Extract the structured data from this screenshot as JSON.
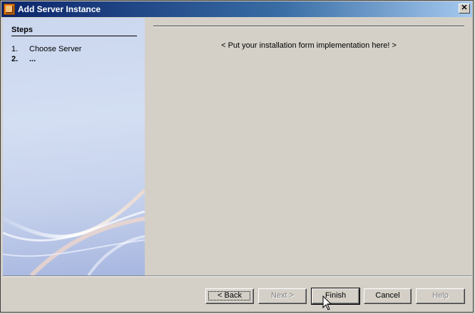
{
  "window": {
    "title": "Add Server Instance",
    "close_glyph": "✕"
  },
  "steps": {
    "title": "Steps",
    "items": [
      {
        "number": "1.",
        "label": "Choose Server"
      },
      {
        "number": "2.",
        "label": "..."
      }
    ]
  },
  "content": {
    "placeholder": "< Put your installation form implementation here! >"
  },
  "buttons": {
    "back": "< Back",
    "next": "Next >",
    "finish": "Finish",
    "cancel": "Cancel",
    "help": "Help"
  },
  "icons": {
    "app": "server-wizard-icon",
    "close": "close-icon",
    "cursor": "mouse-pointer-icon"
  },
  "colors": {
    "titlebar_start": "#0a246a",
    "titlebar_end": "#a6caf0",
    "steps_panel": "#cbd7ee",
    "dialog_bg": "#d4d0c8"
  }
}
